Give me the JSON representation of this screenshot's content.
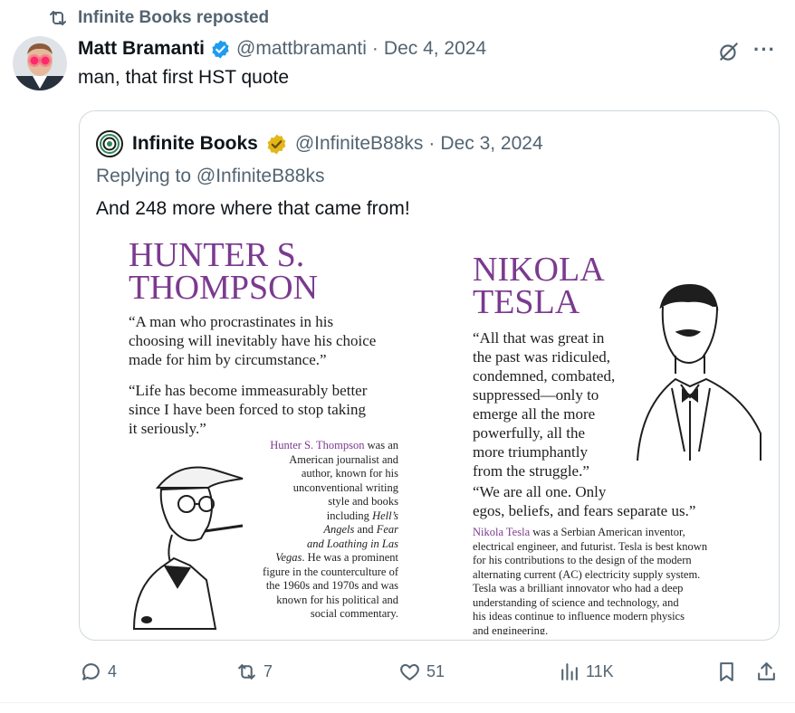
{
  "repost_banner": {
    "text": "Infinite Books reposted"
  },
  "post": {
    "author_name": "Matt Bramanti",
    "handle": "@mattbramanti",
    "separator": "·",
    "date": "Dec 4, 2024",
    "text": "man, that first HST quote"
  },
  "quoted": {
    "author_name": "Infinite Books",
    "handle": "@InfiniteB88ks",
    "separator": "·",
    "date": "Dec 3, 2024",
    "replying_to": "Replying to @InfiniteB88ks",
    "text": "And 248 more where that came from!"
  },
  "image": {
    "left": {
      "name_line1": "HUNTER S.",
      "name_line2": "THOMPSON",
      "quote1": [
        "“A man who procrastinates in his",
        "choosing will inevitably have his choice",
        "made for him by circumstance.”"
      ],
      "quote2": [
        "“Life has become immeasurably better",
        "since I have been forced to stop taking",
        "it seriously.”"
      ],
      "bio_name": "Hunter S. Thompson",
      "bio_lines": [
        " was an",
        "American journalist and",
        "author, known for his",
        "unconventional writing",
        "style and books",
        "including ",
        "Hell’s",
        "Angels",
        " and ",
        "Fear",
        "and Loathing in Las",
        "Vegas",
        ". He was a prominent",
        "figure in the counterculture of",
        "the 1960s and 1970s and was",
        "known for his political and",
        "social commentary."
      ]
    },
    "right": {
      "name_line1": "NIKOLA",
      "name_line2": "TESLA",
      "quote1": [
        "“All that was great in",
        "the past was ridiculed,",
        "condemned, combated,",
        "suppressed—only to",
        "emerge all the more",
        "powerfully, all the",
        "more triumphantly",
        "from the struggle.”"
      ],
      "quote2": [
        "“We are all one. Only",
        "egos, beliefs, and fears separate us.”"
      ],
      "bio_name": "Nikola Tesla",
      "bio_lines": [
        " was a Serbian American inventor,",
        "electrical engineer, and futurist. Tesla is best known",
        "for his contributions to the design of the modern",
        "alternating current (AC) electricity supply system.",
        "Tesla was a brilliant innovator who had a deep",
        "understanding of science and technology, and",
        "his ideas continue to influence modern physics",
        "and engineering."
      ]
    }
  },
  "actions": {
    "replies": "4",
    "reposts": "7",
    "likes": "51",
    "views": "11K"
  },
  "colors": {
    "text_primary": "#0f1419",
    "text_secondary": "#536471",
    "verified_blue": "#1d9bf0",
    "verified_gold": "#e2b719",
    "accent_purple": "#7b3a8f",
    "border": "#cfd9de"
  },
  "icons": [
    "repost-icon",
    "verified-badge-icon",
    "grok-icon",
    "more-icon",
    "gold-badge-icon",
    "reply-icon",
    "like-icon",
    "views-icon",
    "bookmark-icon",
    "share-icon"
  ]
}
